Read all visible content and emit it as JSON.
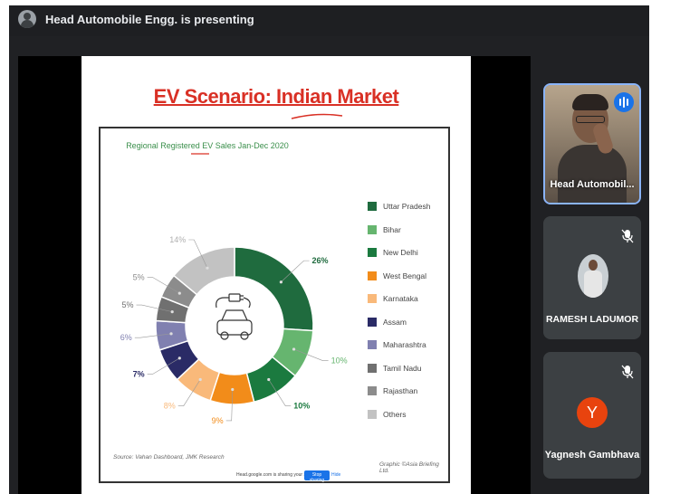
{
  "header": {
    "presenting_text": "Head Automobile Engg. is presenting"
  },
  "slide": {
    "title": "EV Scenario: Indian Market",
    "chart_data": {
      "type": "pie",
      "title": "Regional Registered EV Sales Jan-Dec 2020",
      "categories": [
        "Uttar Pradesh",
        "Bihar",
        "New Delhi",
        "West Bengal",
        "Karnataka",
        "Assam",
        "Maharashtra",
        "Tamil Nadu",
        "Rajasthan",
        "Others"
      ],
      "values": [
        26,
        10,
        10,
        9,
        8,
        7,
        6,
        5,
        5,
        14
      ],
      "labels": [
        "26%",
        "10%",
        "10%",
        "9%",
        "8%",
        "7%",
        "6%",
        "5%",
        "5%",
        "14%"
      ],
      "colors": [
        "#1f6b3e",
        "#66b56f",
        "#1b7a3f",
        "#f28c1a",
        "#f9b97a",
        "#2a2b66",
        "#8080b0",
        "#707070",
        "#8c8c8c",
        "#c2c2c2"
      ],
      "label_colors": [
        "#1f6b3e",
        "#66b56f",
        "#1b7a3f",
        "#f28c1a",
        "#f9b97a",
        "#2a2b66",
        "#8080b0",
        "#707070",
        "#8c8c8c",
        "#b0b0b0"
      ],
      "donut": true,
      "legend_position": "right",
      "source": "Source: Vahan Dashboard, JMK Research",
      "credit": "Graphic ©Asia Briefing Ltd."
    },
    "share_bar": {
      "text": "Head.google.com is sharing your screen.",
      "stop_label": "Stop sharing",
      "hide_label": "Hide"
    }
  },
  "participants": [
    {
      "name": "Head Automobil...",
      "speaking": true,
      "muted": false
    },
    {
      "name": "RAMESH LADUMOR",
      "speaking": false,
      "muted": true
    },
    {
      "name": "Yagnesh Gambhava",
      "initial": "Y",
      "avatar_color": "#e8430e",
      "speaking": false,
      "muted": true
    }
  ]
}
